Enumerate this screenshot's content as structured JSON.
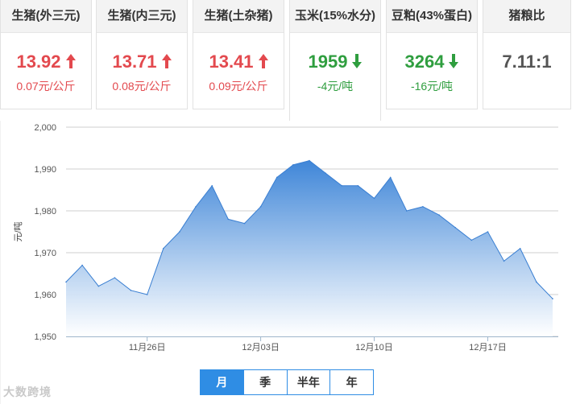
{
  "cards": [
    {
      "title": "生猪(外三元)",
      "price": "13.92",
      "change": "0.07元/公斤",
      "trend": "up"
    },
    {
      "title": "生猪(内三元)",
      "price": "13.71",
      "change": "0.08元/公斤",
      "trend": "up"
    },
    {
      "title": "生猪(土杂猪)",
      "price": "13.41",
      "change": "0.09元/公斤",
      "trend": "up"
    },
    {
      "title": "玉米(15%水分)",
      "price": "1959",
      "change": "-4元/吨",
      "trend": "down"
    },
    {
      "title": "豆粕(43%蛋白)",
      "price": "3264",
      "change": "-16元/吨",
      "trend": "down"
    },
    {
      "title": "猪粮比",
      "price": "7.11:1",
      "change": "",
      "trend": "none"
    }
  ],
  "colors": {
    "up": "#e3494e",
    "down": "#2f9e3f",
    "accent": "#2f8de4",
    "area_top": "#3f86d8"
  },
  "chart_data": {
    "type": "area",
    "ylabel": "元/吨",
    "ylim": [
      1950,
      2000
    ],
    "y_ticks": [
      "1,950",
      "1,960",
      "1,970",
      "1,980",
      "1,990",
      "2,000"
    ],
    "x_ticks": [
      "11月26日",
      "12月03日",
      "12月10日",
      "12月17日"
    ],
    "x_tick_index": [
      5,
      12,
      19,
      26
    ],
    "grid": true,
    "series": [
      {
        "values": [
          1963,
          1967,
          1962,
          1964,
          1961,
          1960,
          1971,
          1975,
          1981,
          1986,
          1978,
          1977,
          1981,
          1988,
          1991,
          1992,
          1989,
          1986,
          1986,
          1983,
          1988,
          1980,
          1981,
          1979,
          1976,
          1973,
          1975,
          1968,
          1971,
          1963,
          1959
        ]
      }
    ]
  },
  "tabs": [
    "月",
    "季",
    "半年",
    "年"
  ],
  "active_tab": 0,
  "watermark": "大数跨境"
}
